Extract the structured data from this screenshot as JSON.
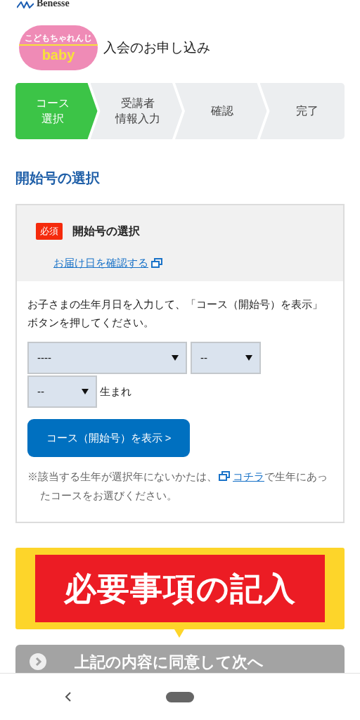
{
  "brand": {
    "corporate": "Benesse",
    "logo_top": "こどもちゃれんじ",
    "logo_main": "baby"
  },
  "page_title": "入会のお申し込み",
  "steps": [
    {
      "lines": [
        "コース",
        "選択"
      ],
      "selected": true
    },
    {
      "lines": [
        "受講者",
        "情報入力"
      ],
      "selected": false
    },
    {
      "lines": [
        "確認"
      ],
      "selected": false
    },
    {
      "lines": [
        "完了"
      ],
      "selected": false
    }
  ],
  "section_heading": "開始号の選択",
  "card": {
    "required_badge": "必須",
    "title": "開始号の選択",
    "delivery_link": "お届け日を確認する",
    "instruction": "お子さまの生年月日を入力して、「コース（開始号）を表示」ボタンを押してください。",
    "selects": [
      {
        "value": "----"
      },
      {
        "value": "--"
      },
      {
        "value": "--"
      }
    ],
    "born_label": "生まれ",
    "show_button": "コース（開始号）を表示 >",
    "note_before": "※該当する生年が選択年にないかたは、",
    "note_link": "コチラ",
    "note_after": "で生年にあったコースをお選びください。"
  },
  "banner": {
    "text": "必要事項の記入"
  },
  "next_button": {
    "label": "上記の内容に同意して次へ",
    "disabled": true
  }
}
